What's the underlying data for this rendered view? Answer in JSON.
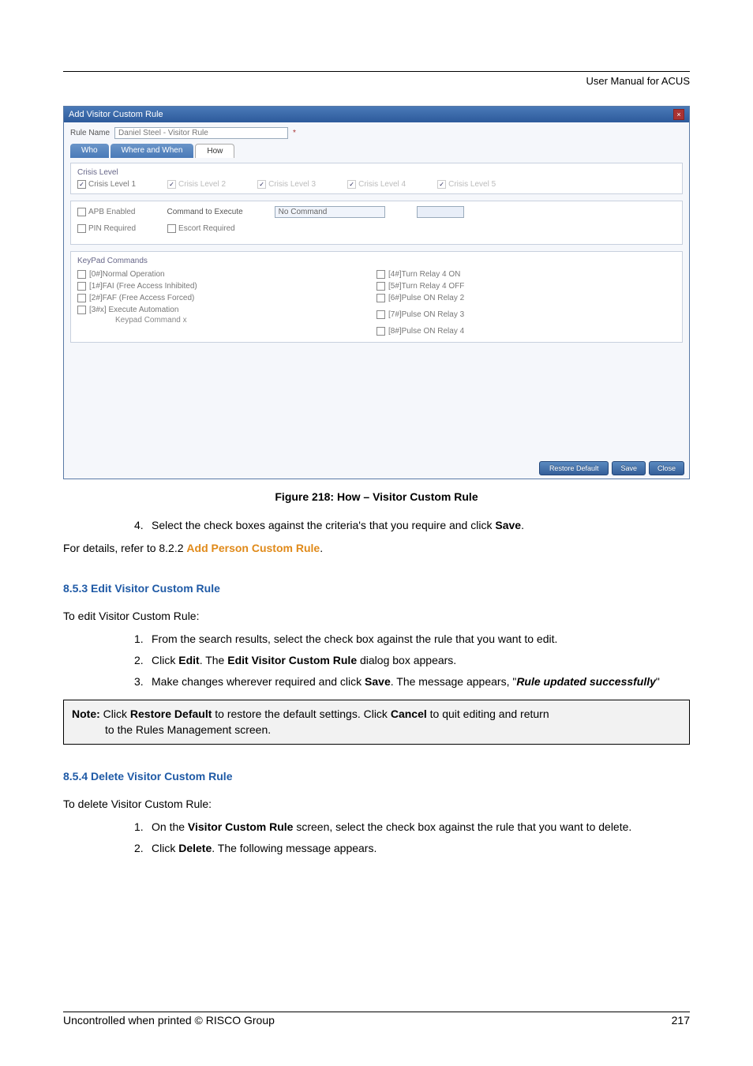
{
  "header": {
    "title": "User Manual for ACUS"
  },
  "screenshot": {
    "dialog_title": "Add Visitor Custom Rule",
    "rule_name_label": "Rule Name",
    "rule_name_value": "Daniel Steel - Visitor Rule",
    "asterisk": "*",
    "tabs": {
      "who": "Who",
      "where_when": "Where and When",
      "how": "How"
    },
    "crisis_panel_title": "Crisis Level",
    "crisis": {
      "l1": "Crisis Level 1",
      "l2": "Crisis Level 2",
      "l3": "Crisis Level 3",
      "l4": "Crisis Level 4",
      "l5": "Crisis Level 5"
    },
    "apb_enabled": "APB Enabled",
    "command_to_execute": "Command to Execute",
    "no_command": "No Command",
    "pin_required": "PIN Required",
    "escort_required": "Escort Required",
    "keypad_title": "KeyPad Commands",
    "left_col": {
      "a": "[0#]Normal Operation",
      "b": "[1#]FAI (Free Access Inhibited)",
      "c": "[2#]FAF (Free Access Forced)",
      "d": "[3#x] Execute Automation",
      "d_sub": "Keypad Command x"
    },
    "right_col": {
      "a": "[4#]Turn Relay 4 ON",
      "b": "[5#]Turn Relay 4 OFF",
      "c": "[6#]Pulse ON Relay 2",
      "d": "[7#]Pulse ON Relay 3",
      "e": "[8#]Pulse ON Relay 4"
    },
    "buttons": {
      "restore": "Restore Default",
      "save": "Save",
      "close": "Close"
    }
  },
  "caption": "Figure 218: How – Visitor Custom Rule",
  "step4_num": "4.",
  "step4_a": "Select the check boxes against the criteria's that you require and click ",
  "step4_b": "Save",
  "step4_c": ".",
  "refer_a": "For details, refer to 8.2.2 ",
  "refer_b": "Add Person Custom Rule",
  "refer_c": ".",
  "sec853_title": "8.5.3  Edit Visitor Custom Rule",
  "sec853_intro": "To edit Visitor Custom Rule:",
  "sec853_items": {
    "i1_num": "1.",
    "i1": "From the search results, select the check box against the rule that you want to edit.",
    "i2_num": "2.",
    "i2_a": "Click ",
    "i2_b": "Edit",
    "i2_c": ". The ",
    "i2_d": "Edit Visitor Custom Rule",
    "i2_e": " dialog box appears.",
    "i3_num": "3.",
    "i3_a": "Make changes wherever required and click ",
    "i3_b": "Save",
    "i3_c": ". The message appears, \"",
    "i3_d": "Rule updated successfully",
    "i3_e": "\""
  },
  "note": {
    "prefix": "Note:",
    "a": " Click ",
    "b": "Restore Default",
    "c": " to restore the default settings. Click ",
    "d": "Cancel",
    "e": " to quit editing and return",
    "f": "to the Rules Management screen."
  },
  "sec854_title": "8.5.4  Delete Visitor Custom Rule",
  "sec854_intro": "To delete Visitor Custom Rule:",
  "sec854_items": {
    "i1_num": "1.",
    "i1_a": "On the ",
    "i1_b": "Visitor Custom Rule",
    "i1_c": " screen, select the check box against the rule that you want to delete.",
    "i2_num": "2.",
    "i2_a": "Click ",
    "i2_b": "Delete",
    "i2_c": ". The following message appears."
  },
  "footer": {
    "left": "Uncontrolled when printed © RISCO Group",
    "right": "217"
  }
}
